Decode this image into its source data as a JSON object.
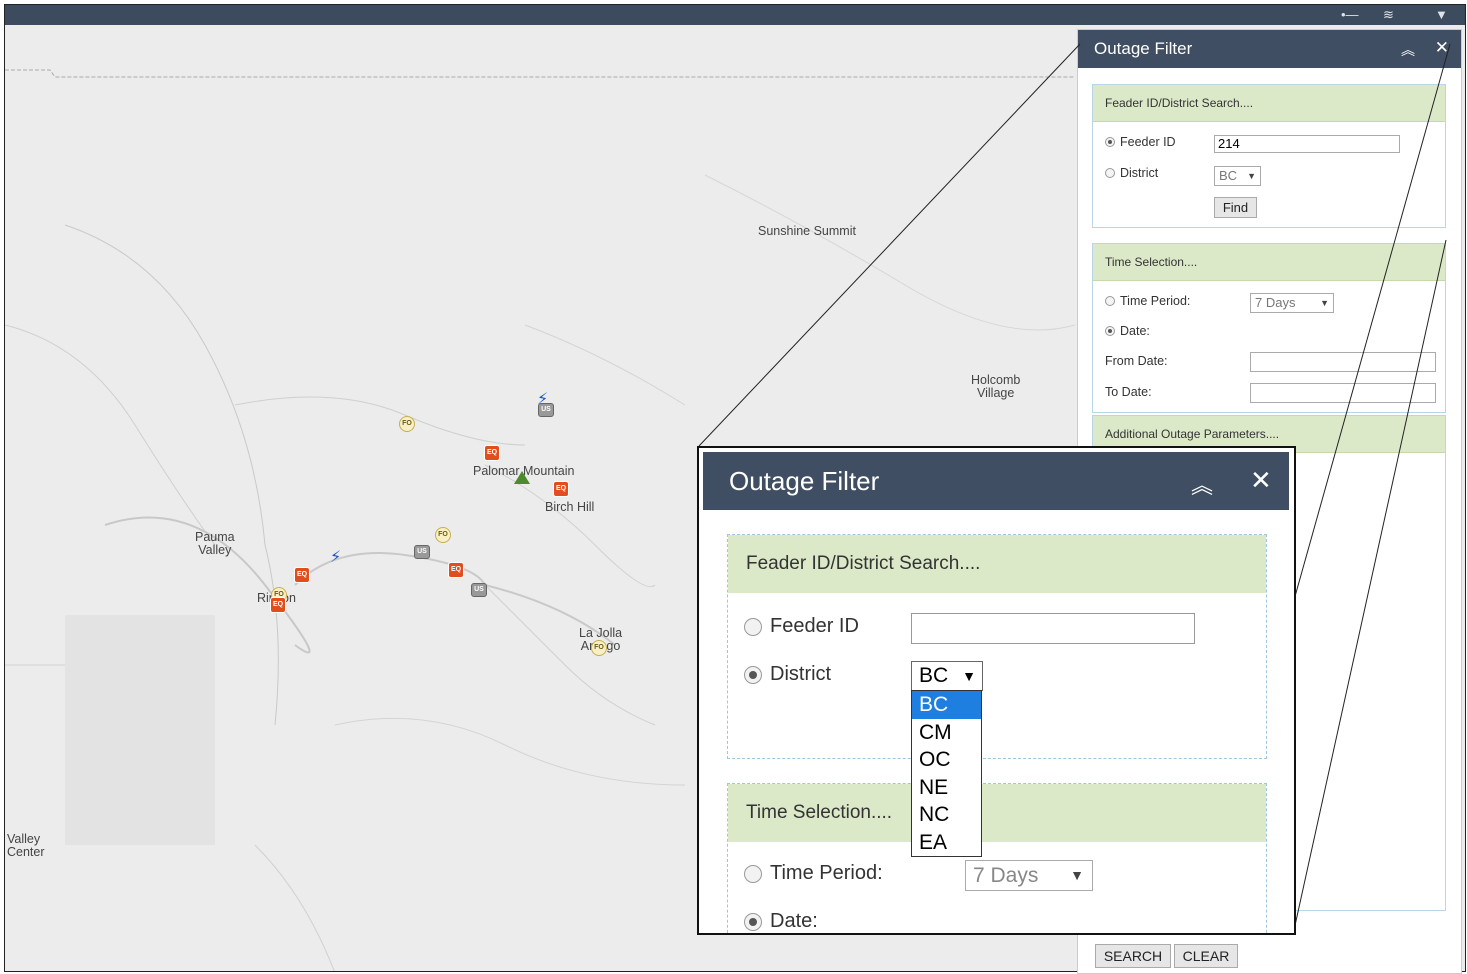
{
  "topbar": {
    "icons": [
      "legend-icon",
      "layers-icon",
      "filter-icon"
    ]
  },
  "map": {
    "places": [
      {
        "name": "Sunshine Summit"
      },
      {
        "name": "Holcomb\nVillage"
      },
      {
        "name": "Palomar Mountain"
      },
      {
        "name": "Birch Hill"
      },
      {
        "name": "Pauma\nValley"
      },
      {
        "name": "Rincon"
      },
      {
        "name": "La Jolla\nAmago"
      },
      {
        "name": "Valley\nCenter"
      }
    ],
    "marker_labels": {
      "eq": "EQ",
      "fo": "FO",
      "us": "US"
    }
  },
  "panel": {
    "title": "Outage Filter",
    "feeder_section": {
      "header": "Feader ID/District Search....",
      "feeder_label": "Feeder ID",
      "feeder_value": "214",
      "district_label": "District",
      "district_value": "BC",
      "find_label": "Find"
    },
    "time_section": {
      "header": "Time Selection....",
      "period_label": "Time Period:",
      "period_value": "7 Days",
      "date_label": "Date:",
      "from_label": "From Date:",
      "to_label": "To Date:"
    },
    "additional_section": {
      "header": "Additional Outage Parameters...."
    },
    "footer": {
      "search_label": "SEARCH",
      "clear_label": "CLEAR"
    }
  },
  "zoom": {
    "title": "Outage Filter",
    "feeder_section": {
      "header": "Feader ID/District Search....",
      "feeder_label": "Feeder ID",
      "feeder_value": "",
      "district_label": "District",
      "district_value": "BC",
      "district_options": [
        "BC",
        "CM",
        "OC",
        "NE",
        "NC",
        "EA"
      ],
      "district_selected": "BC"
    },
    "time_section": {
      "header": "Time Selection....",
      "period_label": "Time Period:",
      "period_value": "7 Days",
      "date_label": "Date:"
    }
  },
  "colors": {
    "header_bg": "#3f4e62",
    "section_header_bg": "#dce9c8",
    "selected_option": "#1e7fe0",
    "outage_marker": "#e24d1c"
  }
}
